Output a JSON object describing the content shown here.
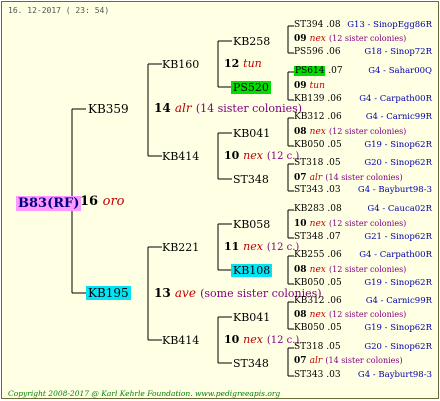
{
  "date": "16. 12-2017 ( 23: 54)",
  "root": {
    "name": "B83(RF)",
    "num": "16",
    "type": "oro"
  },
  "lines_color": "#000000",
  "gen1": [
    {
      "name": "KB359",
      "num": "14",
      "type": "alr",
      "sis": "(14 sister colonies)"
    },
    {
      "name": "KB195",
      "num": "13",
      "type": "ave",
      "sis": "(some sister colonies)"
    }
  ],
  "gen2": [
    {
      "name": "KB160",
      "num": "12",
      "type": "tun",
      "sis": ""
    },
    {
      "name": "KB414",
      "num": "10",
      "type": "nex",
      "sis": "(12 c.)"
    },
    {
      "name": "KB221",
      "num": "11",
      "type": "nex",
      "sis": "(12 c.)"
    },
    {
      "name": "KB414",
      "num": "10",
      "type": "nex",
      "sis": "(12 c.)"
    }
  ],
  "gen3": [
    "KB258",
    "PS520",
    "KB041",
    "ST348",
    "KB058",
    "KB108",
    "KB041",
    "ST348"
  ],
  "gen3_mid": [
    {
      "num": "09",
      "type": "nex",
      "sis": "(12 sister colonies)"
    },
    {
      "num": "09",
      "type": "tun",
      "sis": ""
    },
    {
      "num": "08",
      "type": "nex",
      "sis": "(12 sister colonies)"
    },
    {
      "num": "07",
      "type": "alr",
      "sis": "(14 sister colonies)"
    },
    {
      "num": "10",
      "type": "nex",
      "sis": "(12 sister colonies)"
    },
    {
      "num": "08",
      "type": "nex",
      "sis": "(12 sister colonies)"
    },
    {
      "num": "08",
      "type": "nex",
      "sis": "(12 sister colonies)"
    },
    {
      "num": "07",
      "type": "alr",
      "sis": "(14 sister colonies)"
    }
  ],
  "gen4": [
    {
      "name": "ST394",
      "yr": ".08",
      "loc": "G13 - SinopEgg86R"
    },
    {
      "name": "PS596",
      "yr": ".06",
      "loc": "G18 - Sinop72R"
    },
    {
      "name": "PS614",
      "yr": ".07",
      "loc": "G4 - Sahar00Q"
    },
    {
      "name": "KB139",
      "yr": ".06",
      "loc": "G4 - Carpath00R"
    },
    {
      "name": "KB312",
      "yr": ".06",
      "loc": "G4 - Carnic99R"
    },
    {
      "name": "KB050",
      "yr": ".05",
      "loc": "G19 - Sinop62R"
    },
    {
      "name": "ST318",
      "yr": ".05",
      "loc": "G20 - Sinop62R"
    },
    {
      "name": "ST343",
      "yr": ".03",
      "loc": "G4 - Bayburt98-3"
    },
    {
      "name": "KB283",
      "yr": ".08",
      "loc": "G4 - Cauca02R"
    },
    {
      "name": "ST348",
      "yr": ".07",
      "loc": "G21 - Sinop62R"
    },
    {
      "name": "KB255",
      "yr": ".06",
      "loc": "G4 - Carpath00R"
    },
    {
      "name": "KB050",
      "yr": ".05",
      "loc": "G19 - Sinop62R"
    },
    {
      "name": "KB312",
      "yr": ".06",
      "loc": "G4 - Carnic99R"
    },
    {
      "name": "KB050",
      "yr": ".05",
      "loc": "G19 - Sinop62R"
    },
    {
      "name": "ST318",
      "yr": ".05",
      "loc": "G20 - Sinop62R"
    },
    {
      "name": "ST343",
      "yr": ".03",
      "loc": "G4 - Bayburt98-3"
    }
  ],
  "footer": "Copyright 2008-2017 @ Karl Kehrle Foundation.   www.pedigreeapis.org"
}
